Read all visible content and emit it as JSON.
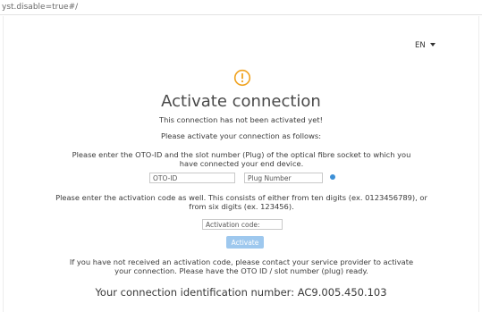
{
  "browser": {
    "url_fragment": "yst.disable=true#/"
  },
  "header": {
    "language": "EN"
  },
  "main": {
    "title": "Activate connection",
    "not_activated": "This connection has not been activated yet!",
    "activate_as_follows": "Please activate your connection as follows:",
    "instruction_oto": "Please enter the OTO-ID and the slot number (Plug) of the optical fibre socket to which you have connected your end device.",
    "oto_id_placeholder": "OTO-ID",
    "plug_number_placeholder": "Plug Number",
    "instruction_code": "Please enter the activation code as well. This consists of either from ten digits (ex. 0123456789), or from six digits (ex. 123456).",
    "activation_code_placeholder": "Activation code:",
    "activate_label": "Activate",
    "help_text": "If you have not received an activation code, please contact your service provider to activate your connection. Please have the OTO ID / slot number (plug) ready.",
    "connection_id": "Your connection identification number: AC9.005.450.103"
  },
  "colors": {
    "warning": "#f0a21f",
    "button_disabled": "#9ec8ee",
    "info": "#3c8fd6"
  }
}
